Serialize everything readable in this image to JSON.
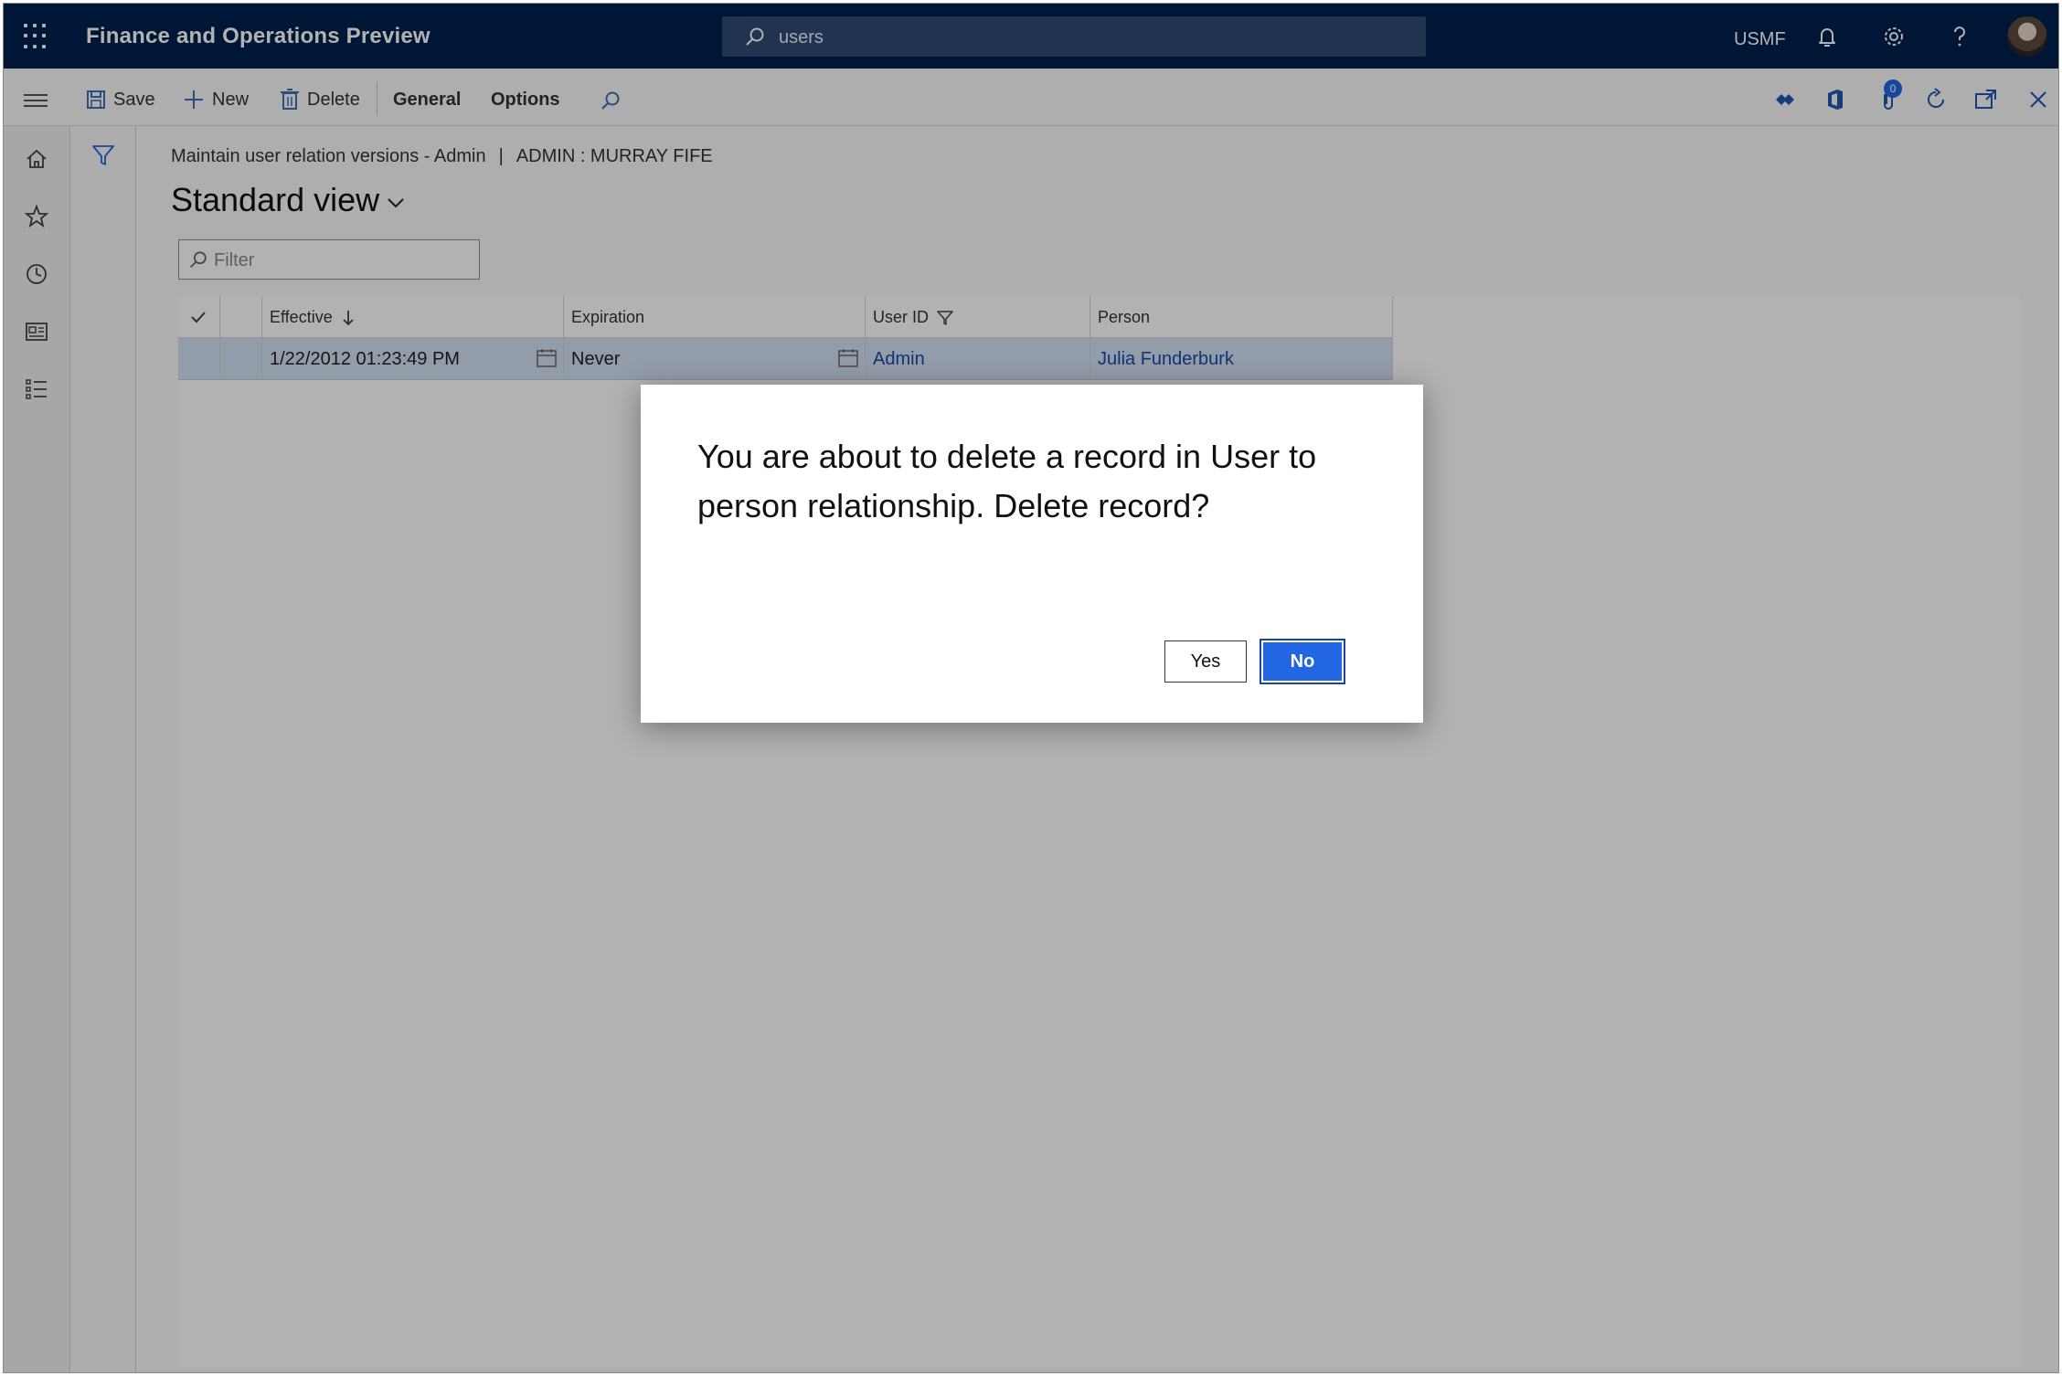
{
  "app": {
    "title": "Finance and Operations Preview"
  },
  "search": {
    "value": "users"
  },
  "header": {
    "company": "USMF"
  },
  "command_bar": {
    "save": "Save",
    "new": "New",
    "delete": "Delete",
    "general": "General",
    "options": "Options",
    "attachments_count": "0"
  },
  "page": {
    "caption_form": "Maintain user relation versions - Admin",
    "caption_separator": "|",
    "caption_record": "ADMIN : MURRAY FIFE",
    "view_title": "Standard view",
    "filter_placeholder": "Filter"
  },
  "grid": {
    "columns": [
      "Effective",
      "Expiration",
      "User ID",
      "Person"
    ],
    "rows": [
      {
        "effective": "1/22/2012 01:23:49 PM",
        "expiration": "Never",
        "user_id": "Admin",
        "person": "Julia Funderburk"
      }
    ]
  },
  "dialog": {
    "message": "You are about to delete a record in User to person relationship. Delete record?",
    "yes": "Yes",
    "no": "No"
  },
  "colors": {
    "navbar": "#002050",
    "accent": "#2266e3",
    "link": "#1a4ba8",
    "selected_row": "#d3e0f3"
  }
}
